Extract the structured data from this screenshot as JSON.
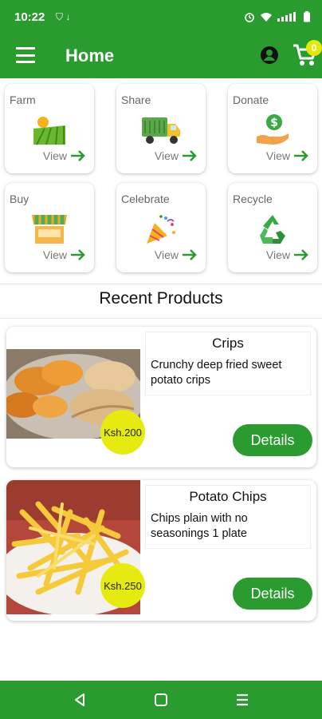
{
  "status_bar": {
    "time": "10:22",
    "left_icons": "⛉  ↓"
  },
  "app_bar": {
    "title": "Home",
    "cart_count": "0"
  },
  "categories": [
    {
      "label": "Farm",
      "view": "View",
      "icon": "farm-icon"
    },
    {
      "label": "Share",
      "view": "View",
      "icon": "truck-icon"
    },
    {
      "label": "Donate",
      "view": "View",
      "icon": "donate-icon"
    },
    {
      "label": "Buy",
      "view": "View",
      "icon": "market-stall-icon"
    },
    {
      "label": "Celebrate",
      "view": "View",
      "icon": "party-popper-icon"
    },
    {
      "label": "Recycle",
      "view": "View",
      "icon": "recycle-icon"
    }
  ],
  "section": {
    "title": "Recent Products"
  },
  "products": [
    {
      "name": "Crips",
      "description": "Crunchy deep fried sweet potato crips",
      "price": "Ksh.200",
      "details_label": "Details"
    },
    {
      "name": "Potato Chips",
      "description": "Chips plain with no seasonings 1 plate",
      "price": "Ksh.250",
      "details_label": "Details"
    }
  ],
  "colors": {
    "primary": "#2a9b2f",
    "badge": "#e6ea10"
  }
}
